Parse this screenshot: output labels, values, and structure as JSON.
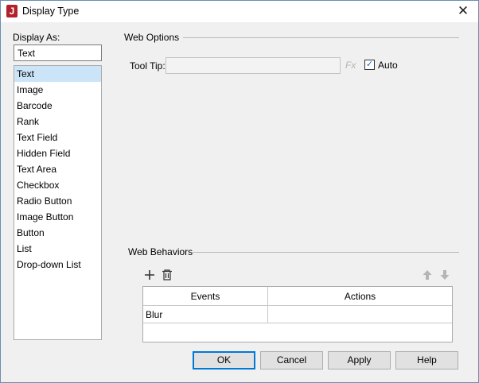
{
  "window": {
    "title": "Display Type",
    "app_icon": "J",
    "close_glyph": "✕"
  },
  "display_as": {
    "label": "Display As:",
    "value": "Text",
    "items": [
      "Text",
      "Image",
      "Barcode",
      "Rank",
      "Text Field",
      "Hidden Field",
      "Text Area",
      "Checkbox",
      "Radio Button",
      "Image Button",
      "Button",
      "List",
      "Drop-down List"
    ],
    "selected": "Text"
  },
  "web_options": {
    "title": "Web Options",
    "tooltip_label": "Tool Tip:",
    "tooltip_value": "",
    "fx_label": "Fx",
    "auto_label": "Auto",
    "auto_checked": true
  },
  "web_behaviors": {
    "title": "Web Behaviors",
    "columns": [
      "Events",
      "Actions"
    ],
    "rows": [
      {
        "event": "Blur",
        "action": ""
      }
    ],
    "icons": {
      "add": "plus-icon",
      "delete": "trash-icon",
      "up": "arrow-up-icon",
      "down": "arrow-down-icon"
    }
  },
  "buttons": {
    "ok": "OK",
    "cancel": "Cancel",
    "apply": "Apply",
    "help": "Help"
  },
  "colors": {
    "selection": "#cce4f7",
    "accent": "#0078d7",
    "check": "#1e64c8",
    "app_icon": "#b3202a"
  }
}
